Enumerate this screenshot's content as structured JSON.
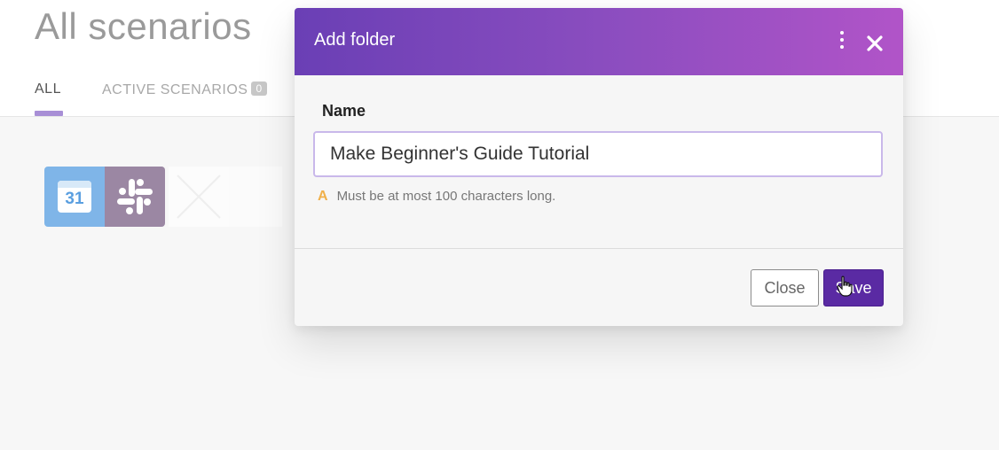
{
  "page": {
    "title": "All scenarios",
    "tabs": [
      {
        "label": "ALL"
      },
      {
        "label": "ACTIVE SCENARIOS",
        "count": "0"
      }
    ],
    "scenario": {
      "calendar_day": "31",
      "modules": [
        "calendar-icon",
        "slack-icon"
      ]
    }
  },
  "modal": {
    "title": "Add folder",
    "field_label": "Name",
    "name_value": "Make Beginner's Guide Tutorial",
    "hint_icon": "A",
    "hint_text": "Must be at most 100 characters long.",
    "close_label": "Close",
    "save_label": "Save"
  },
  "colors": {
    "header_gradient_start": "#6a3fb5",
    "header_gradient_end": "#b154c8",
    "save_button": "#5a2aa3",
    "input_border": "#c9b8ea",
    "warning": "#f0b04a",
    "tab_indicator": "#a88fd6"
  }
}
